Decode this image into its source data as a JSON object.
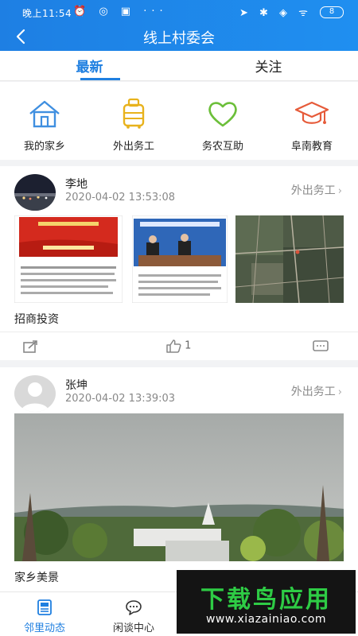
{
  "status_bar": {
    "time": "晚上11:54",
    "battery": "8"
  },
  "header": {
    "title": "线上村委会"
  },
  "tabs": [
    {
      "label": "最新",
      "active": true
    },
    {
      "label": "关注",
      "active": false
    }
  ],
  "categories": [
    {
      "label": "我的家乡",
      "icon": "home-icon"
    },
    {
      "label": "外出务工",
      "icon": "suitcase-icon"
    },
    {
      "label": "务农互助",
      "icon": "heart-icon"
    },
    {
      "label": "阜南教育",
      "icon": "graduation-cap-icon"
    }
  ],
  "posts": [
    {
      "author": "李地",
      "time": "2020-04-02 13:53:08",
      "tag": "外出务工",
      "title": "招商投资",
      "likes": "1"
    },
    {
      "author": "张坤",
      "time": "2020-04-02 13:39:03",
      "tag": "外出务工",
      "title": "家乡美景"
    }
  ],
  "bottom_nav": [
    {
      "label": "邻里动态",
      "active": true
    },
    {
      "label": "闲谈中心",
      "active": false
    }
  ],
  "watermark": {
    "title": "下载鸟应用",
    "url": "www.xiazainiao.com"
  },
  "colors": {
    "accent": "#1f7fe0",
    "header": "#1e7fe3",
    "watermark_green": "#2ecc45"
  }
}
